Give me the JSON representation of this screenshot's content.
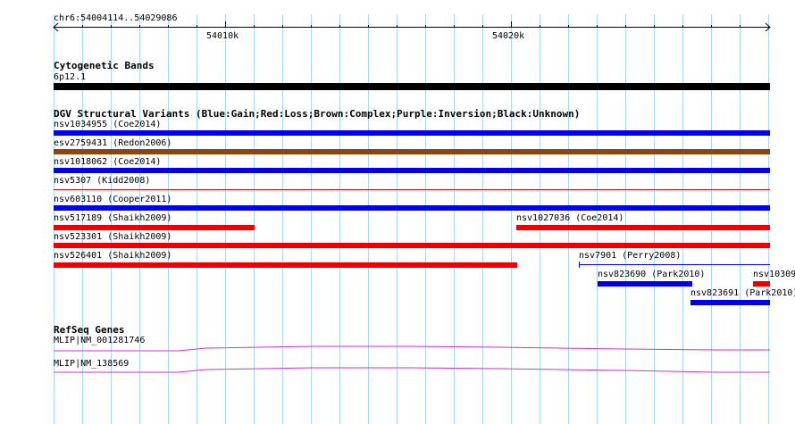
{
  "browser": {
    "location": "chr6:54004114..54029086",
    "ruler_labels": [
      "54010k",
      "54020k"
    ]
  },
  "tracks": {
    "cytobands": {
      "title": "Cytogenetic Bands",
      "band_label": "6p12.1"
    },
    "dgv": {
      "title": "DGV Structural Variants (Blue:Gain;Red:Loss;Brown:Complex;Purple:Inversion;Black:Unknown)",
      "features": [
        {
          "label": "nsv1034955 (Coe2014)",
          "type": "gain"
        },
        {
          "label": "esv2759431 (Redon2006)",
          "type": "complex"
        },
        {
          "label": "nsv1018062 (Coe2014)",
          "type": "gain"
        },
        {
          "label": "nsv5307 (Kidd2008)",
          "type": "loss"
        },
        {
          "label": "nsv603110 (Cooper2011)",
          "type": "gain"
        },
        {
          "label": "nsv517189 (Shaikh2009)",
          "type": "loss"
        },
        {
          "label": "nsv1027036 (Coe2014)",
          "type": "loss"
        },
        {
          "label": "nsv523301 (Shaikh2009)",
          "type": "loss"
        },
        {
          "label": "nsv526401 (Shaikh2009)",
          "type": "loss"
        },
        {
          "label": "nsv7901 (Perry2008)",
          "type": "gain"
        },
        {
          "label": "nsv823690 (Park2010)",
          "type": "gain"
        },
        {
          "label": "nsv10309",
          "type": "loss"
        },
        {
          "label": "nsv823691 (Park2010)",
          "type": "gain"
        }
      ]
    },
    "refseq": {
      "title": "RefSeq Genes",
      "transcripts": [
        "MLIP|NM_001281746",
        "MLIP|NM_138569"
      ]
    }
  },
  "colors": {
    "gain": "#0000ee",
    "loss": "#ee0000",
    "complex": "#8b4513",
    "cytoband": "#000000",
    "gene": "#cc33cc",
    "gridline": "#a8d8f0"
  }
}
